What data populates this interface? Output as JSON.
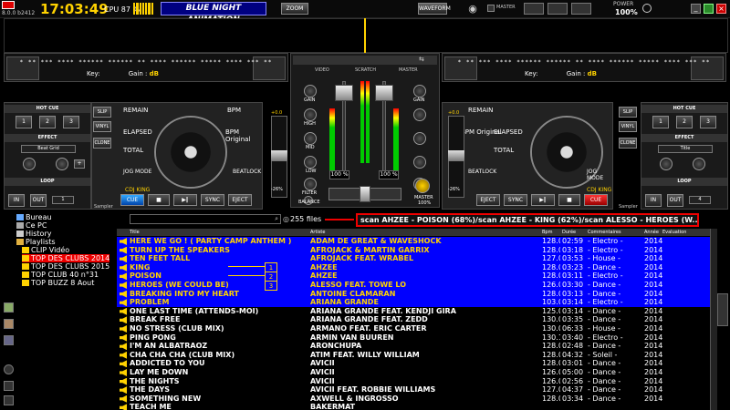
{
  "app": {
    "version": "8.0.0 b2412",
    "clock": "17:03:49",
    "cpu": "CPU 87 %",
    "skin_name": "BLUE NIGHT ANIMATION",
    "zoom_label": "ZOOM",
    "waveform_label": "WAVEFORM",
    "master_label": "MASTER",
    "power_label": "POWER",
    "power_value": "100%"
  },
  "deck_left": {
    "stars": "* ** *** **** ****** ****** ** **** ****** ***** **** *** **",
    "key_label": "Key:",
    "gain_label": "Gain :",
    "gain_unit": "dB",
    "remain": "REMAIN",
    "elapsed": "ELAPSED",
    "total": "TOTAL",
    "bpm": "BPM",
    "bpm_original": "BPM Original",
    "beatlock": "BEATLOCK",
    "jog_mode": "JOG MODE",
    "cdj_king": "CDJ KING",
    "pitch_top": "+0.0",
    "pitch_bot": "-26%",
    "cue": "CUE",
    "sync": "SYNC",
    "eject": "EJECT",
    "slip": "SLIP",
    "vinyl": "VINYL",
    "clone": "CLONE",
    "sampler": "Sampler"
  },
  "deck_right": {
    "stars": "* ** *** **** ****** ****** ** **** ****** ***** **** *** **",
    "key_label": "Key:",
    "gain_label": "Gain :",
    "gain_unit": "dB",
    "remain": "REMAIN",
    "elapsed": "ELAPSED",
    "total": "TOTAL",
    "bpm": "BPM",
    "bpm_original": "BPM Original",
    "beatlock": "BEATLOCK",
    "jog_mode": "JOG MODE",
    "cdj_king": "CDJ KING",
    "pitch_top": "+0.0",
    "pitch_bot": "-26%",
    "cue": "CUE",
    "sync": "SYNC",
    "eject": "EJECT",
    "slip": "SLIP",
    "vinyl": "VINYL",
    "clone": "CLONE",
    "sampler": "Sampler"
  },
  "side_left": {
    "hot_cue": "HOT CUE",
    "hc1": "1",
    "hc2": "2",
    "hc3": "3",
    "effect": "EFFECT",
    "effect_sel": "Beat Grid",
    "loop": "LOOP",
    "in": "IN",
    "out": "OUT",
    "loop_val": "1"
  },
  "side_right": {
    "hot_cue": "HOT CUE",
    "hc1": "1",
    "hc2": "2",
    "hc3": "3",
    "effect": "EFFECT",
    "effect_sel": "Title",
    "loop": "LOOP",
    "in": "IN",
    "out": "OUT",
    "loop_val": "4"
  },
  "mixer": {
    "video": "VIDEO",
    "scratch": "SCRATCH",
    "master": "MASTER",
    "gain": "GAIN",
    "high": "HIGH",
    "mid": "MID",
    "low": "LOW",
    "filter": "FILTER",
    "balance": "BALANCE",
    "vol_l": "100 %",
    "vol_r": "100 %",
    "master_val": "MASTER",
    "master_pct": "100%"
  },
  "tree": [
    {
      "label": "Bureau"
    },
    {
      "label": "Ce PC"
    },
    {
      "label": "History"
    },
    {
      "label": "Playlists"
    },
    {
      "label": "CLIP Vidéo"
    },
    {
      "label": "TOP DES CLUBS 2014"
    },
    {
      "label": "TOP DES CLUBS 2015"
    },
    {
      "label": "TOP CLUB 40 n°31"
    },
    {
      "label": "TOP BUZZ 8 Aout"
    }
  ],
  "browser": {
    "files_count": "255 files",
    "scan_text": "scan AHZEE - POISON (68%)/scan AHZEE - KING  (62%)/scan ALESSO - HEROES (W... (43%) + 2 more",
    "headers": {
      "title": "Title",
      "artist": "Artiste",
      "bpm": "Bpm",
      "dur": "Durée",
      "com": "Commentaires",
      "year": "Année",
      "eval": "Evaluation"
    },
    "numbers": [
      "1",
      "2",
      "3"
    ]
  },
  "rows": [
    {
      "title": "HERE WE GO ! ( PARTY CAMP ANTHEM )",
      "artist": "ADAM DE GREAT & WAVESHOCK",
      "bpm": "128.0",
      "dur": "02:59",
      "com": "- Electro -",
      "year": "2014",
      "sel": true
    },
    {
      "title": "TURN UP THE SPEAKERS",
      "artist": "AFROJACK & MARTIN GARRIX",
      "bpm": "128.0",
      "dur": "03:18",
      "com": "- Electro -",
      "year": "2014",
      "sel": true
    },
    {
      "title": "TEN FEET TALL",
      "artist": "AFROJACK FEAT. WRABEL",
      "bpm": "127.0",
      "dur": "03:53",
      "com": "- House -",
      "year": "2014",
      "sel": true
    },
    {
      "title": "KING",
      "artist": "AHZEE",
      "bpm": "128.0",
      "dur": "03:23",
      "com": "- Dance -",
      "year": "2014",
      "sel": true
    },
    {
      "title": "POISON",
      "artist": "AHZEE",
      "bpm": "128.0",
      "dur": "03:11",
      "com": "- Electro -",
      "year": "2014",
      "sel": true
    },
    {
      "title": "HEROES (WE COULD BE)",
      "artist": "ALESSO FEAT. TOWE LO",
      "bpm": "126.0",
      "dur": "03:30",
      "com": "- Dance -",
      "year": "2014",
      "sel": true
    },
    {
      "title": "BREAKING INTO MY HEART",
      "artist": "ANTOINE CLAMARAN",
      "bpm": "128.0",
      "dur": "03:13",
      "com": "- Dance -",
      "year": "2014",
      "sel": true
    },
    {
      "title": "PROBLEM",
      "artist": "ARIANA GRANDE",
      "bpm": "103.0",
      "dur": "03:14",
      "com": "- Electro -",
      "year": "2014",
      "sel": true
    },
    {
      "title": "ONE LAST TIME (ATTENDS-MOI)",
      "artist": "ARIANA GRANDE FEAT. KENDJI GIRA",
      "bpm": "125.0",
      "dur": "03:14",
      "com": "- Dance -",
      "year": "2014",
      "sel": false
    },
    {
      "title": "BREAK FREE",
      "artist": "ARIANA GRANDE FEAT. ZEDD",
      "bpm": "130.0",
      "dur": "03:35",
      "com": "- Dance -",
      "year": "2014",
      "sel": false
    },
    {
      "title": "NO STRESS (CLUB MIX)",
      "artist": "ARMANO FEAT. ERIC CARTER",
      "bpm": "130.0",
      "dur": "06:33",
      "com": "- House -",
      "year": "2014",
      "sel": false
    },
    {
      "title": "PING PONG",
      "artist": "ARMIN VAN BUUREN",
      "bpm": "130.1",
      "dur": "03:40",
      "com": "- Electro -",
      "year": "2014",
      "sel": false
    },
    {
      "title": "I'M AN ALBATRAOZ",
      "artist": "ARONCHUPA",
      "bpm": "128.0",
      "dur": "02:48",
      "com": "- Dance -",
      "year": "2014",
      "sel": false
    },
    {
      "title": "CHA CHA CHA (CLUB MIX)",
      "artist": "ATIM  FEAT. WILLY WILLIAM",
      "bpm": "128.0",
      "dur": "04:32",
      "com": "- Soleil -",
      "year": "2014",
      "sel": false
    },
    {
      "title": "ADDICTED TO YOU",
      "artist": "AVICII",
      "bpm": "128.0",
      "dur": "03:01",
      "com": "- Dance -",
      "year": "2014",
      "sel": false
    },
    {
      "title": "LAY ME DOWN",
      "artist": "AVICII",
      "bpm": "126.0",
      "dur": "05:00",
      "com": "- Dance -",
      "year": "2014",
      "sel": false
    },
    {
      "title": "THE NIGHTS",
      "artist": "AVICII",
      "bpm": "126.0",
      "dur": "02:56",
      "com": "- Dance -",
      "year": "2014",
      "sel": false
    },
    {
      "title": "THE DAYS",
      "artist": "AVICII FEAT. ROBBIE WILLIAMS",
      "bpm": "127.0",
      "dur": "04:37",
      "com": "- Dance -",
      "year": "2014",
      "sel": false
    },
    {
      "title": "SOMETHING NEW",
      "artist": "AXWELL & INGROSSO",
      "bpm": "128.0",
      "dur": "03:34",
      "com": "- Dance -",
      "year": "2014",
      "sel": false
    },
    {
      "title": "TEACH ME",
      "artist": "BAKERMAT",
      "bpm": "",
      "dur": "",
      "com": "",
      "year": "",
      "sel": false
    }
  ],
  "colors": {
    "accent": "#ffd200",
    "selection": "#0000ff",
    "alert": "#ee0000"
  }
}
